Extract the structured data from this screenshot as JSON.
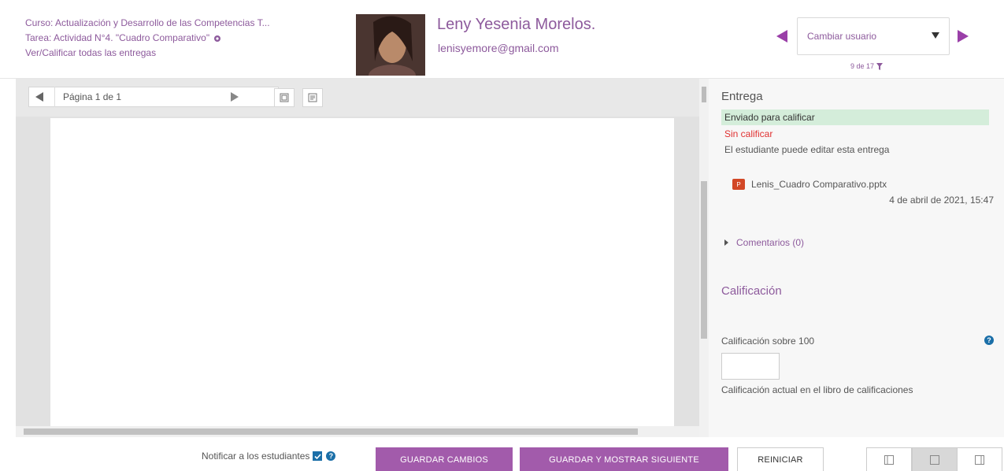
{
  "header": {
    "course_line": "Curso: Actualización y Desarrollo de las Competencias T...",
    "task_line": "Tarea: Actividad N°4. \"Cuadro Comparativo\"",
    "view_all_link": "Ver/Calificar todas las entregas",
    "user_name": "Leny Yesenia Morelos.",
    "user_email": "lenisyemore@gmail.com",
    "change_user_placeholder": "Cambiar usuario",
    "user_count": "9 de 17"
  },
  "pdf": {
    "page_label": "Página 1 de 1"
  },
  "submission": {
    "title": "Entrega",
    "status_submitted": "Enviado para calificar",
    "status_grading": "Sin calificar",
    "status_edit": "El estudiante puede editar esta entrega",
    "file_name": "Lenis_Cuadro Comparativo.pptx",
    "file_date": "4 de abril de 2021, 15:47",
    "comments": "Comentarios (0)"
  },
  "grade": {
    "title": "Calificación",
    "label": "Calificación sobre 100",
    "value": "",
    "current_label": "Calificación actual en el libro de calificaciones"
  },
  "footer": {
    "notify_label": "Notificar a los estudiantes",
    "notify_checked": true,
    "save_label": "GUARDAR CAMBIOS",
    "save_next_label": "GUARDAR Y MOSTRAR SIGUIENTE",
    "reset_label": "REINICIAR"
  },
  "colors": {
    "accent": "#a25bab",
    "link": "#8d5a9c",
    "success_bg": "#d4edda",
    "error": "#e03131"
  }
}
